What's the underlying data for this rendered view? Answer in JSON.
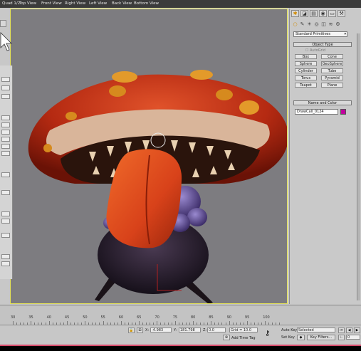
{
  "menubar": {
    "items": [
      "Quad 1/2",
      "Top View",
      "Front View",
      "Right View",
      "Left View",
      "Back View",
      "Bottom View"
    ]
  },
  "command_panel": {
    "dropdown_value": "Standard Primitives",
    "object_type_header": "Object Type",
    "autogrid_label": "AutoGrid",
    "primitives": [
      "Box",
      "Cone",
      "Sphere",
      "GeoSphere",
      "Cylinder",
      "Tube",
      "Torus",
      "Pyramid",
      "Teapot",
      "Plane"
    ],
    "name_color_header": "Name and Color",
    "object_name": "DrawCall_0124",
    "object_color": "#c2009e"
  },
  "timeline": {
    "ticks": [
      "30",
      "35",
      "40",
      "45",
      "50",
      "55",
      "60",
      "65",
      "70",
      "75",
      "80",
      "85",
      "90",
      "95",
      "100"
    ]
  },
  "statusbar": {
    "x_label": "X:",
    "x_value": "-4.983",
    "y_label": "Y:",
    "y_value": "181.798",
    "z_label": "Z:",
    "z_value": "0.0",
    "grid_text": "Grid = 10.0",
    "add_time_tag": "Add Time Tag",
    "autokey_label": "Auto Key",
    "selected_value": "Selected",
    "setkey_label": "Set Key",
    "key_filters_label": "Key Filters...",
    "frame_value": "0"
  },
  "viewport": {
    "border_color": "#e8e65a",
    "background": "#7d7c80"
  }
}
